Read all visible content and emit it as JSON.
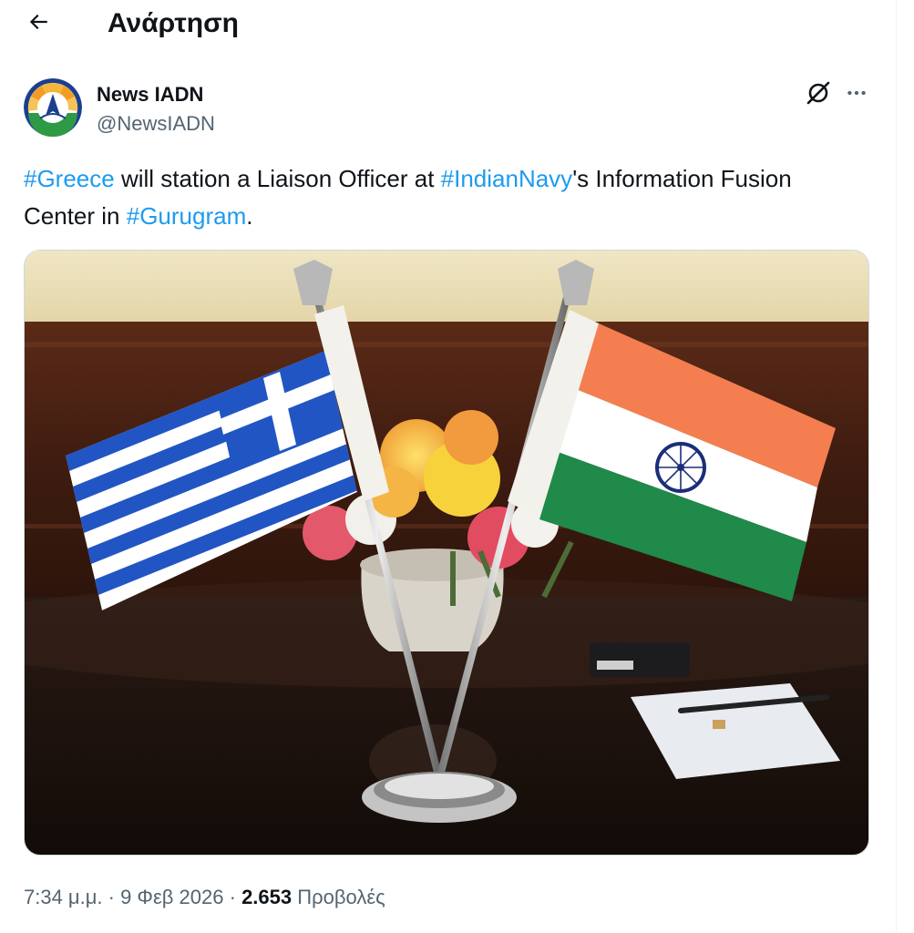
{
  "header": {
    "title": "Ανάρτηση",
    "back_icon": "arrow-left-icon"
  },
  "author": {
    "display_name": "News IADN",
    "handle": "@NewsIADN",
    "avatar_icon": "news-iadn-logo",
    "grok_icon": "grok-icon",
    "more_icon": "more-horizontal-icon"
  },
  "tweet": {
    "segments": [
      {
        "text": "#Greece",
        "hashtag": true
      },
      {
        "text": " will station a Liaison Officer at ",
        "hashtag": false
      },
      {
        "text": "#IndianNavy",
        "hashtag": true
      },
      {
        "text": "'s Information Fusion Center in ",
        "hashtag": false
      },
      {
        "text": "#Gurugram",
        "hashtag": true
      },
      {
        "text": ".",
        "hashtag": false
      }
    ]
  },
  "meta": {
    "time": "7:34 μ.μ.",
    "separator": " · ",
    "date": "9 Φεβ 2026",
    "views_count": "2.653",
    "views_label": "Προβολές"
  },
  "colors": {
    "accent": "#1d9bf0",
    "text_primary": "#0f1419",
    "text_secondary": "#536471",
    "border": "#cfd9de"
  }
}
